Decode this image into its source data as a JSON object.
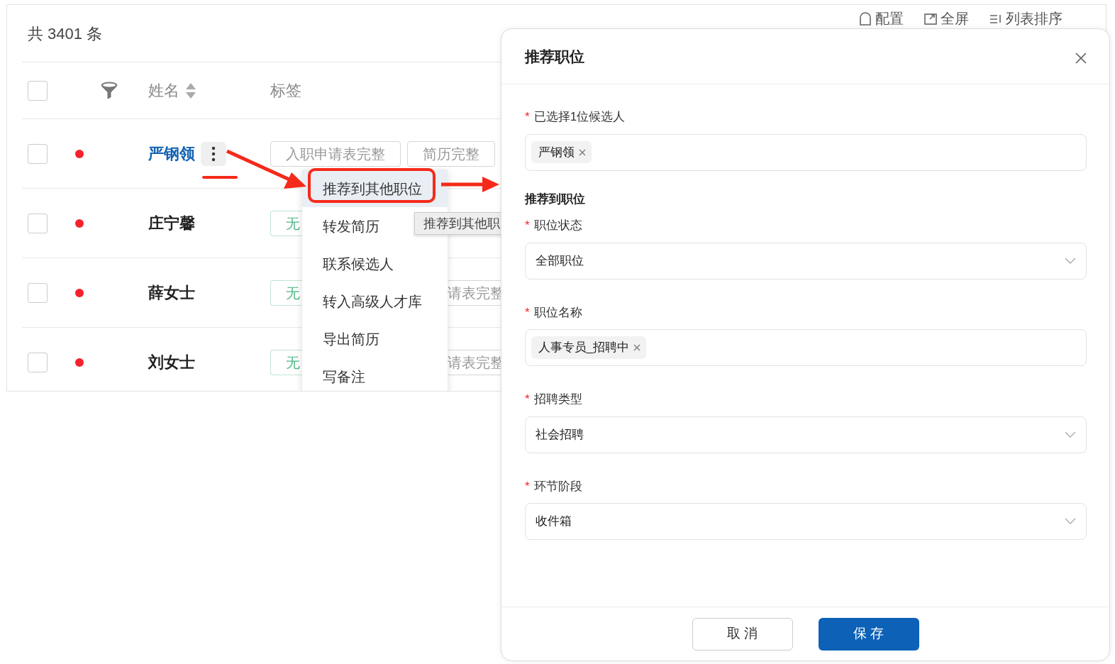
{
  "summary": {
    "total": "共 3401 条"
  },
  "toolbar": [
    {
      "label": "配置",
      "kind": "config"
    },
    {
      "label": "全屏",
      "kind": "fullscreen"
    },
    {
      "label": "列表排序",
      "kind": "sort"
    }
  ],
  "table": {
    "header_checked": false,
    "columns": [
      "姓名",
      "标签"
    ],
    "rows": [
      {
        "name": "严钢领",
        "checked": false,
        "selected": true,
        "color": "#f5222d",
        "tags": [
          {
            "text": "入职申请表完整",
            "color": "#999999"
          },
          {
            "text": "简历完整",
            "color": "#999999"
          }
        ]
      },
      {
        "name": "庄宁馨",
        "checked": false,
        "selected": false,
        "color": "#f5222d",
        "tags": [
          {
            "text": "无",
            "color": "#52b788"
          }
        ]
      },
      {
        "name": "薛女士",
        "checked": false,
        "selected": false,
        "color": "#f5222d",
        "tags": [
          {
            "text": "无",
            "color": "#52b788"
          },
          {
            "text": "请表完整",
            "color": "#999999"
          }
        ]
      },
      {
        "name": "刘女士",
        "checked": false,
        "selected": false,
        "color": "#f5222d",
        "tags": [
          {
            "text": "无",
            "color": "#52b788"
          },
          {
            "text": "请表完整",
            "color": "#999999"
          }
        ]
      }
    ]
  },
  "context_menu": {
    "items": [
      {
        "label": "推荐到其他职位",
        "selected": true
      },
      {
        "label": "转发简历",
        "selected": false
      },
      {
        "label": "联系候选人",
        "selected": false
      },
      {
        "label": "转入高级人才库",
        "selected": false
      },
      {
        "label": "导出简历",
        "selected": false
      },
      {
        "label": "写备注",
        "selected": false
      }
    ]
  },
  "tooltip": "推荐到其他职",
  "dialog": {
    "title": "推荐职位",
    "required_mark": "*",
    "fields": [
      {
        "label": "已选择1位候选人",
        "required": true,
        "kind": "tags",
        "values": [
          "严钢领"
        ]
      },
      {
        "kind": "section",
        "label": "推荐到职位"
      },
      {
        "label": "职位状态",
        "required": true,
        "kind": "select",
        "value": "全部职位"
      },
      {
        "label": "职位名称",
        "required": true,
        "kind": "tags",
        "values": [
          "人事专员_招聘中"
        ]
      },
      {
        "label": "招聘类型",
        "required": true,
        "kind": "select",
        "value": "社会招聘"
      },
      {
        "label": "环节阶段",
        "required": true,
        "kind": "select",
        "value": "收件箱"
      }
    ],
    "buttons": [
      {
        "label": "取 消",
        "kind": "secondary"
      },
      {
        "label": "保 存",
        "kind": "primary"
      }
    ]
  }
}
